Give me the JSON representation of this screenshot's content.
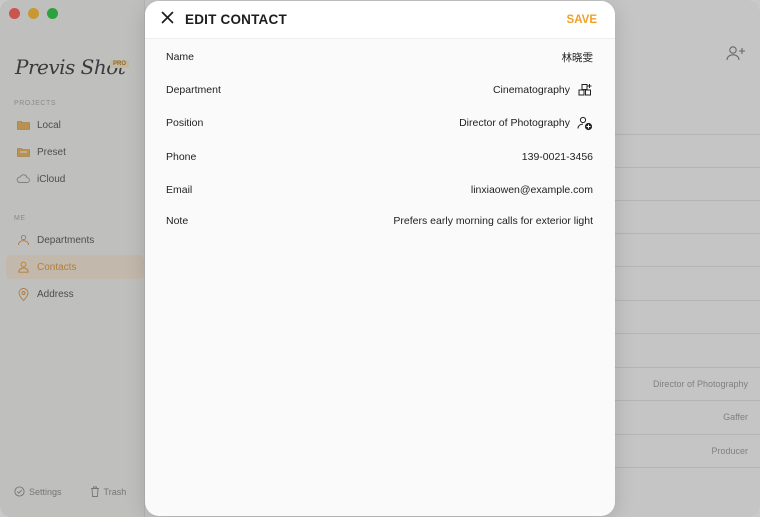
{
  "app": {
    "logo_text": "Previs Shot",
    "logo_badge": "PRO"
  },
  "sidebar": {
    "section_projects": "PROJECTS",
    "section_me": "ME",
    "projects": [
      {
        "label": "Local",
        "icon": "folder-icon"
      },
      {
        "label": "Preset",
        "icon": "preset-folder-icon"
      },
      {
        "label": "iCloud",
        "icon": "cloud-icon"
      }
    ],
    "me": [
      {
        "label": "Departments",
        "icon": "departments-icon"
      },
      {
        "label": "Contacts",
        "icon": "person-icon",
        "active": true
      },
      {
        "label": "Address",
        "icon": "location-pin-icon"
      }
    ],
    "footer": {
      "settings_label": "Settings",
      "trash_label": "Trash"
    }
  },
  "background_list": {
    "rows": [
      "Director of Photography",
      "Gaffer",
      "Producer"
    ]
  },
  "modal": {
    "title": "EDIT CONTACT",
    "save_label": "SAVE",
    "fields": {
      "name": {
        "label": "Name",
        "value": "林晓雯"
      },
      "department": {
        "label": "Department",
        "value": "Cinematography"
      },
      "position": {
        "label": "Position",
        "value": "Director of Photography"
      },
      "phone": {
        "label": "Phone",
        "value": "139-0021-3456"
      },
      "email": {
        "label": "Email",
        "value": "linxiaowen@example.com"
      },
      "note": {
        "label": "Note",
        "value": "Prefers early morning calls for exterior light"
      }
    }
  },
  "colors": {
    "accent": "#f0a128",
    "active_bg": "#f6e8d6"
  }
}
